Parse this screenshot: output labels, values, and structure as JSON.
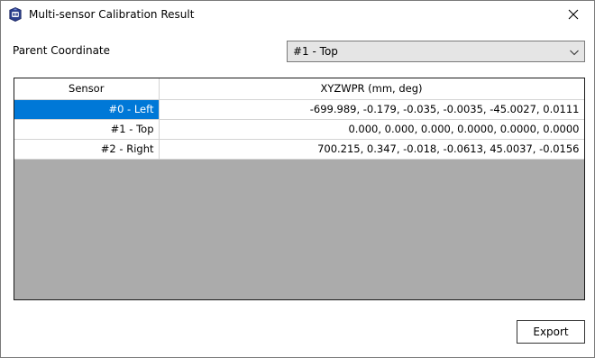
{
  "window": {
    "title": "Multi-sensor Calibration Result",
    "app_icon": "app-logo-icon",
    "close_icon": "close-icon"
  },
  "parent_coordinate": {
    "label": "Parent Coordinate",
    "selected": "#1 - Top"
  },
  "table": {
    "headers": [
      "Sensor",
      "XYZWPR (mm, deg)"
    ],
    "rows": [
      {
        "sensor": "#0 - Left",
        "xyzwpr": "-699.989, -0.179, -0.035, -0.0035, -45.0027, 0.0111",
        "selected": true
      },
      {
        "sensor": "#1 - Top",
        "xyzwpr": "0.000, 0.000, 0.000, 0.0000, 0.0000, 0.0000",
        "selected": false
      },
      {
        "sensor": "#2 - Right",
        "xyzwpr": "700.215, 0.347, -0.018, -0.0613, 45.0037, -0.0156",
        "selected": false
      }
    ]
  },
  "buttons": {
    "export_label": "Export"
  },
  "colors": {
    "selection": "#0078d7",
    "grid_background": "#ababab"
  }
}
